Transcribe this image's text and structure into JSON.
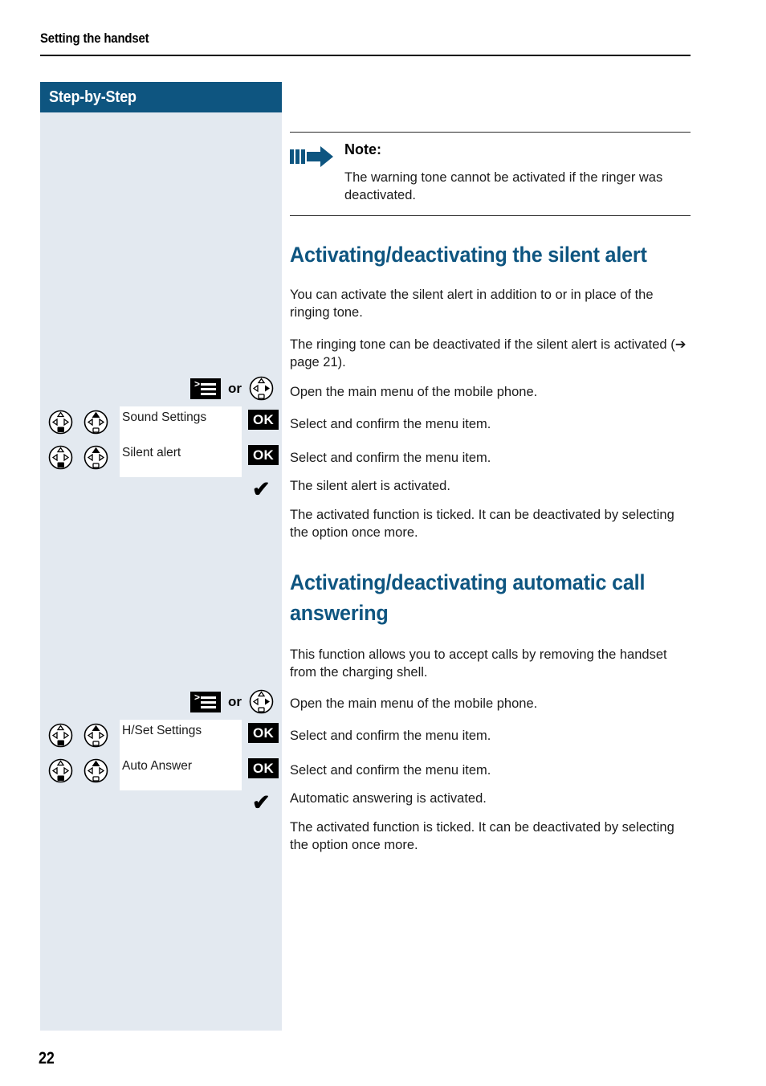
{
  "page": {
    "running_head": "Setting the handset",
    "page_number": "22",
    "accent_blue": "#0e5580",
    "sidebar_bg": "#e3e9f0"
  },
  "sidebar": {
    "banner_label": "Step-by-Step",
    "or_label": "or",
    "ok_label": "OK",
    "tick_glyph": "✔",
    "groups": [
      {
        "menu_row": {
          "menu_icon": "menu-softkey-icon",
          "or": "or",
          "nav_icon": "nav-key-right-icon"
        },
        "steps": [
          {
            "nav_icon_1": "nav-key-down-icon",
            "nav_icon_2": "nav-key-up-icon",
            "label": "Sound Settings",
            "confirm": "OK"
          },
          {
            "nav_icon_1": "nav-key-down-icon",
            "nav_icon_2": "nav-key-up-icon",
            "label": "Silent alert",
            "confirm": "OK"
          }
        ]
      },
      {
        "menu_row": {
          "menu_icon": "menu-softkey-icon",
          "or": "or",
          "nav_icon": "nav-key-right-icon"
        },
        "steps": [
          {
            "nav_icon_1": "nav-key-down-icon",
            "nav_icon_2": "nav-key-up-icon",
            "label": "H/Set Settings",
            "confirm": "OK"
          },
          {
            "nav_icon_1": "nav-key-down-icon",
            "nav_icon_2": "nav-key-up-icon",
            "label": "Auto Answer",
            "confirm": "OK"
          }
        ]
      }
    ]
  },
  "content": {
    "note": {
      "icon": "note-arrow-icon",
      "title": "Note:",
      "body": "The warning tone cannot be activated if the ringer was deactivated."
    },
    "section1": {
      "heading": "Activating/deactivating the silent alert",
      "p1": "You can activate the silent alert in addition to or in place of the ringing tone.",
      "p2": "The ringing tone can be deactivated if the silent alert is activated (➔ page 21).",
      "p3": "Open the main menu of the mobile phone.",
      "p4": "Select and confirm the menu item.",
      "p5": "Select and confirm the menu item.",
      "p6": "The silent alert is activated.",
      "p7": "The activated function is ticked. It can be deactivated by selecting the option once more."
    },
    "section2": {
      "heading": "Activating/deactivating automatic call answering",
      "p1": "This function allows you to accept calls by removing the handset from the charging shell.",
      "p2": "Open the main menu of the mobile phone.",
      "p3": "Select and confirm the menu item.",
      "p4": "Select and confirm the menu item.",
      "p5": "Automatic answering is activated.",
      "p6": "The activated function is ticked. It can be deactivated by selecting the option once more."
    }
  }
}
